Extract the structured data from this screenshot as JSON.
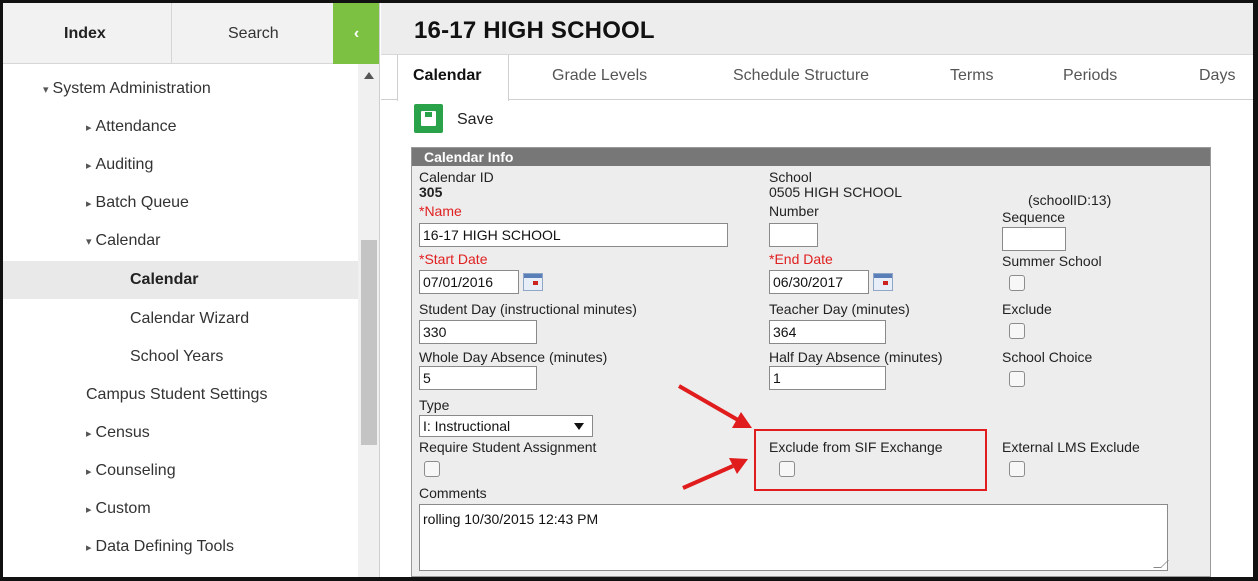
{
  "left_panel": {
    "tabs": {
      "index": "Index",
      "search": "Search",
      "collapse": "‹"
    },
    "tree": [
      {
        "label": "System Administration",
        "caret": "▾"
      },
      {
        "label": "Attendance",
        "caret": "▸"
      },
      {
        "label": "Auditing",
        "caret": "▸"
      },
      {
        "label": "Batch Queue",
        "caret": "▸"
      },
      {
        "label": "Calendar",
        "caret": "▾"
      },
      {
        "label": "Calendar",
        "caret": ""
      },
      {
        "label": "Calendar Wizard",
        "caret": ""
      },
      {
        "label": "School Years",
        "caret": ""
      },
      {
        "label": "Campus Student Settings",
        "caret": ""
      },
      {
        "label": "Census",
        "caret": "▸"
      },
      {
        "label": "Counseling",
        "caret": "▸"
      },
      {
        "label": "Custom",
        "caret": "▸"
      },
      {
        "label": "Data Defining Tools",
        "caret": "▸"
      }
    ]
  },
  "header": {
    "title": "16-17 HIGH SCHOOL"
  },
  "nav_tabs": [
    "Calendar",
    "Grade Levels",
    "Schedule Structure",
    "Terms",
    "Periods",
    "Days"
  ],
  "toolbar": {
    "save_label": "Save"
  },
  "calendar_info": {
    "header": "Calendar Info",
    "calendar_id_label": "Calendar ID",
    "calendar_id": "305",
    "school_label": "School",
    "school_value": "0505 HIGH SCHOOL",
    "school_id": "(schoolID:13)",
    "name_label": "*Name",
    "name_value": "16-17 HIGH SCHOOL",
    "number_label": "Number",
    "number_value": "",
    "sequence_label": "Sequence",
    "sequence_value": "",
    "start_date_label": "*Start Date",
    "start_date_value": "07/01/2016",
    "end_date_label": "*End Date",
    "end_date_value": "06/30/2017",
    "summer_school_label": "Summer School",
    "student_day_label": "Student Day (instructional minutes)",
    "student_day_value": "330",
    "teacher_day_label": "Teacher Day (minutes)",
    "teacher_day_value": "364",
    "exclude_label": "Exclude",
    "whole_day_label": "Whole Day Absence (minutes)",
    "whole_day_value": "5",
    "half_day_label": "Half Day Absence (minutes)",
    "half_day_value": "1",
    "school_choice_label": "School Choice",
    "type_label": "Type",
    "type_value": "I: Instructional",
    "require_assignment_label": "Require Student Assignment",
    "exclude_sif_label": "Exclude from SIF Exchange",
    "external_lms_label": "External LMS Exclude",
    "comments_label": "Comments",
    "comments_value": "rolling 10/30/2015 12:43 PM"
  },
  "colors": {
    "accent_green": "#7cc142",
    "save_green": "#2aa24a",
    "required_red": "#e02020",
    "annotation_red": "#e01c1c",
    "section_header_gray": "#777777"
  }
}
